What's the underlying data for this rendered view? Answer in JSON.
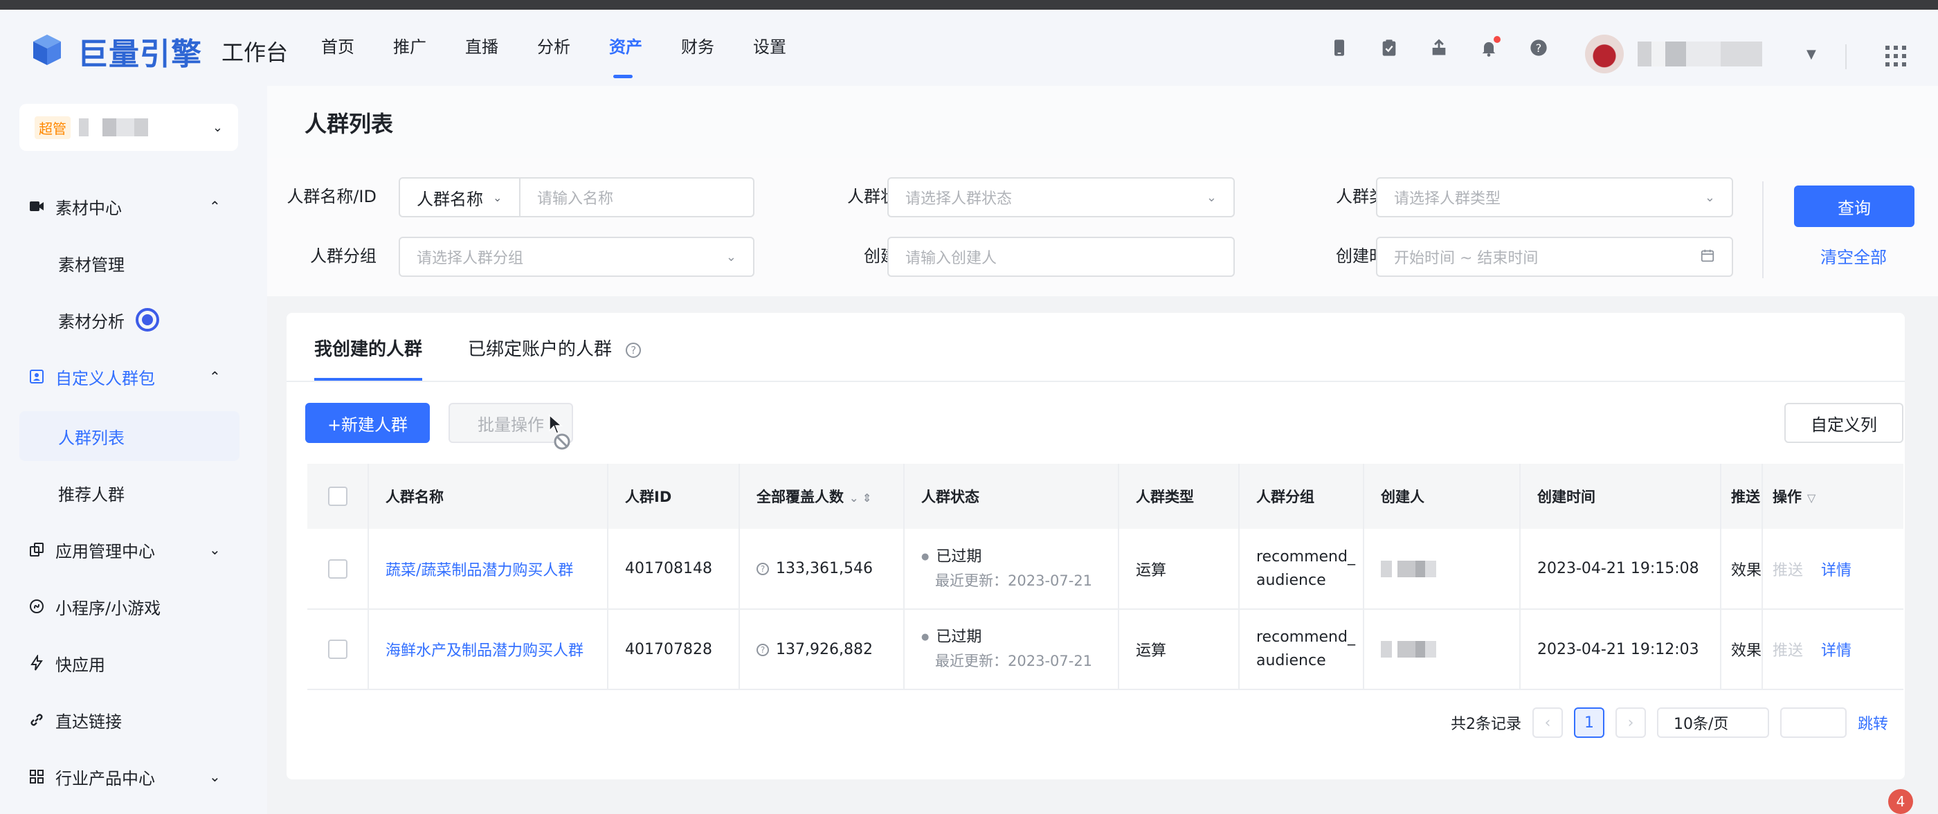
{
  "app": {
    "brand": "巨量引擎",
    "subtitle": "工作台"
  },
  "topnav": [
    {
      "label": "首页",
      "active": false
    },
    {
      "label": "推广",
      "active": false
    },
    {
      "label": "直播",
      "active": false
    },
    {
      "label": "分析",
      "active": false
    },
    {
      "label": "资产",
      "active": true
    },
    {
      "label": "财务",
      "active": false
    },
    {
      "label": "设置",
      "active": false
    }
  ],
  "toolbar_icons": [
    "phone-icon",
    "clipboard-icon",
    "share-icon",
    "bell-icon",
    "help-icon"
  ],
  "sidebar": {
    "account_badge": "超管",
    "items": [
      {
        "label": "素材中心",
        "icon": "video-icon",
        "expanded": true
      },
      {
        "label": "素材管理",
        "sub": true
      },
      {
        "label": "素材分析",
        "sub": true
      },
      {
        "label": "自定义人群包",
        "icon": "audience-icon",
        "expanded": true
      },
      {
        "label": "人群列表",
        "sub": true,
        "selected": true
      },
      {
        "label": "推荐人群",
        "sub": true
      },
      {
        "label": "应用管理中心",
        "icon": "app-icon",
        "expanded": false
      },
      {
        "label": "小程序/小游戏",
        "icon": "miniapp-icon"
      },
      {
        "label": "快应用",
        "icon": "bolt-icon"
      },
      {
        "label": "直达链接",
        "icon": "link-icon"
      },
      {
        "label": "行业产品中心",
        "icon": "grid-icon",
        "expanded": false
      }
    ]
  },
  "page": {
    "title": "人群列表"
  },
  "filters": {
    "name_label": "人群名称/ID",
    "name_select": "人群名称",
    "name_placeholder": "请输入名称",
    "status_label": "人群状态",
    "status_placeholder": "请选择人群状态",
    "type_label": "人群类型",
    "type_placeholder": "请选择人群类型",
    "group_label": "人群分组",
    "group_placeholder": "请选择人群分组",
    "creator_label": "创建人",
    "creator_placeholder": "请输入创建人",
    "time_label": "创建时间",
    "time_placeholder": "开始时间 ~ 结束时间",
    "query_button": "查询",
    "clear_link": "清空全部"
  },
  "tabs": [
    {
      "label": "我创建的人群",
      "active": true
    },
    {
      "label": "已绑定账户的人群",
      "active": false
    }
  ],
  "actions": {
    "new_button": "+新建人群",
    "batch_button": "批量操作",
    "columns_button": "自定义列"
  },
  "table": {
    "headers": [
      "人群名称",
      "人群ID",
      "全部覆盖人数",
      "人群状态",
      "人群类型",
      "人群分组",
      "创建人",
      "创建时间",
      "推送",
      "操作"
    ],
    "rows": [
      {
        "name": "蔬菜/蔬菜制品潜力购买人群",
        "id": "401708148",
        "coverage": "133,361,546",
        "status": "已过期",
        "updated": "最近更新：2023-07-21",
        "type": "运算",
        "group": "recommend_ audience",
        "created": "2023-04-21 19:15:08",
        "push": "效果",
        "op_push": "推送",
        "op_detail": "详情"
      },
      {
        "name": "海鲜水产及制品潜力购买人群",
        "id": "401707828",
        "coverage": "137,926,882",
        "status": "已过期",
        "updated": "最近更新：2023-07-21",
        "type": "运算",
        "group": "recommend_ audience",
        "created": "2023-04-21 19:12:03",
        "push": "效果",
        "op_push": "推送",
        "op_detail": "详情"
      }
    ]
  },
  "pagination": {
    "total": "共2条记录",
    "current_page": "1",
    "page_size": "10条/页",
    "jump": "跳转"
  },
  "notification_count": "4",
  "colors": {
    "accent": "#3370ff",
    "brand": "#2e66d4"
  }
}
